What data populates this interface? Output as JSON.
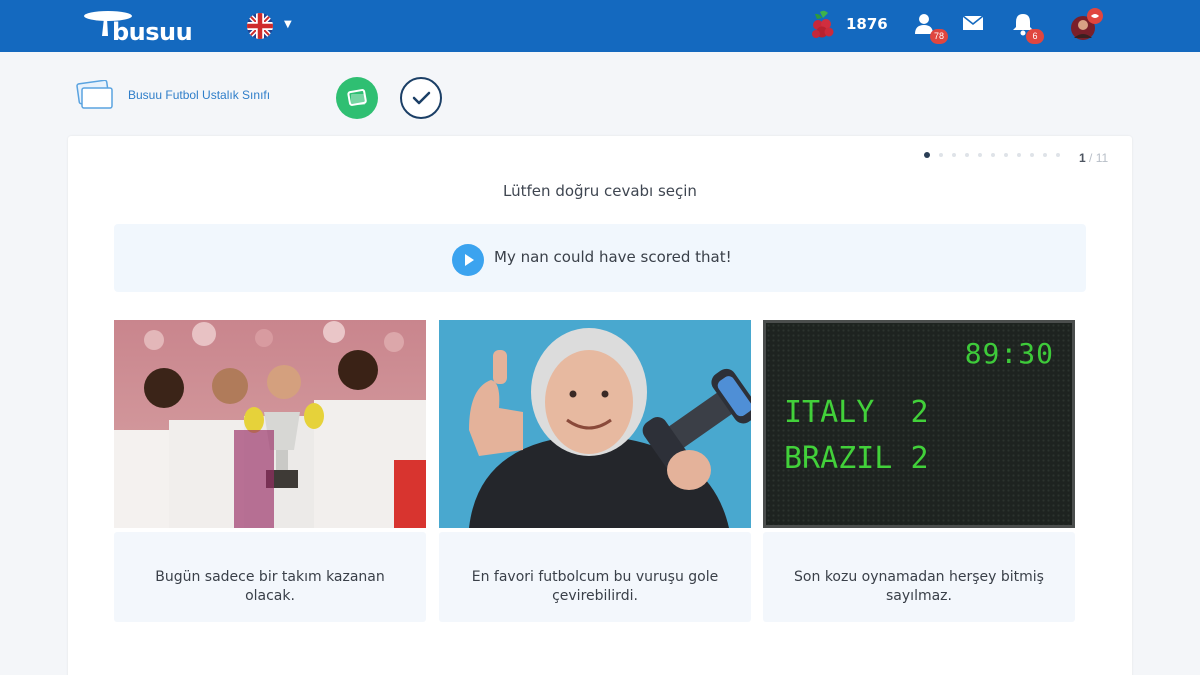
{
  "header": {
    "logo_text": "busuu",
    "language_flag": "uk-flag-icon",
    "points_icon": "berry-icon",
    "points": "1876",
    "friends_badge": "78",
    "notifications_badge": "6",
    "colors": {
      "bar": "#1469bf",
      "badge": "#e0463f"
    }
  },
  "breadcrumb": {
    "label": "Busuu Futbol Ustalık Sınıfı"
  },
  "exercise": {
    "progress_current": "1",
    "progress_total": "/ 11",
    "instruction": "Lütfen doğru cevabı seçin",
    "prompt": "My nan could have scored that!",
    "options": [
      {
        "image": "celebrating-team-photo",
        "caption": "Bugün sadece bir takım kazanan olacak."
      },
      {
        "image": "grandmother-with-dumbbell-photo",
        "caption": "En favori futbolcum bu vuruşu gole çevirebilirdi."
      },
      {
        "image": "scoreboard-photo",
        "caption": "Son kozu oynamadan herşey bitmiş sayılmaz.",
        "scoreboard": {
          "time": "89:30",
          "team1": "ITALY",
          "score1": "2",
          "team2": "BRAZIL",
          "score2": "2"
        }
      }
    ]
  }
}
